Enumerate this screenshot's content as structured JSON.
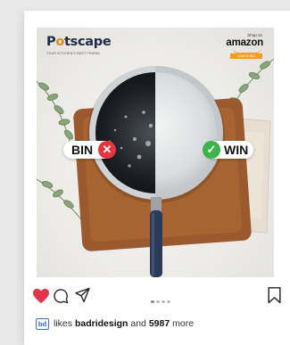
{
  "post": {
    "brand": {
      "name_before": "P",
      "name_after": "tscape",
      "tagline": "YOUR KITCHEN'S BEST FRIEND"
    },
    "shop": {
      "shop_on": "Shop on",
      "store": "amazon",
      "button": "LINK IN BIO"
    },
    "labels": {
      "bad": "BIN",
      "good": "WIN"
    }
  },
  "actions": {
    "carousel": {
      "count": 4,
      "active": 1
    }
  },
  "likes": {
    "liker_logo": "bd",
    "prefix": "likes",
    "user": "badridesign",
    "middle": "and",
    "count": "5987",
    "suffix": "more"
  },
  "colors": {
    "like_heart": "#e0364a",
    "brand_navy": "#1e2a46",
    "brand_orange": "#e2891c",
    "amazon_orange": "#f29d1e",
    "bad_red": "#e6343e",
    "good_green": "#3cb44a",
    "pan_handle": "#2a3a58"
  },
  "icons": [
    "heart-icon",
    "comment-icon",
    "share-icon",
    "bookmark-icon",
    "cross-icon",
    "check-icon"
  ]
}
